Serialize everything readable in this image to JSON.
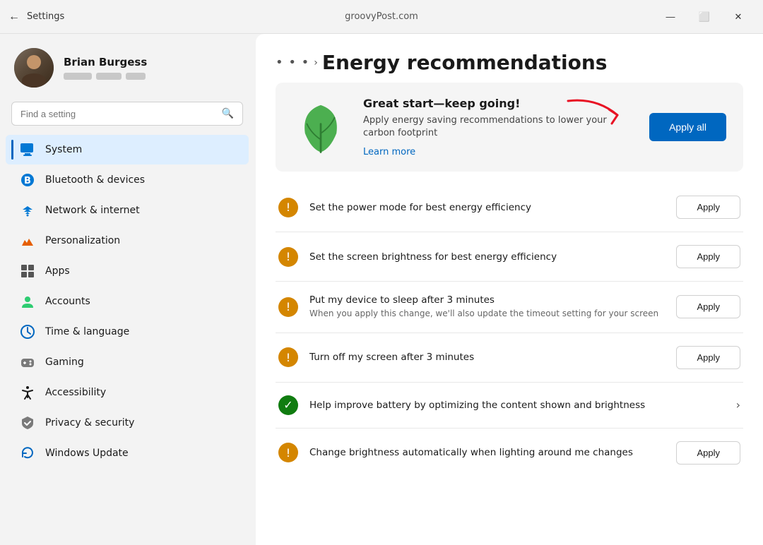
{
  "window": {
    "title": "Settings",
    "center_text": "groovyPost.com",
    "back_icon": "←",
    "minimize_icon": "—",
    "maximize_icon": "⬜",
    "close_icon": "✕"
  },
  "user": {
    "name": "Brian Burgess",
    "bar_widths": [
      40,
      36,
      28
    ]
  },
  "search": {
    "placeholder": "Find a setting"
  },
  "nav": {
    "items": [
      {
        "id": "system",
        "label": "System",
        "icon": "🖥",
        "active": true
      },
      {
        "id": "bluetooth",
        "label": "Bluetooth & devices",
        "icon": "⬡",
        "active": false
      },
      {
        "id": "network",
        "label": "Network & internet",
        "icon": "📶",
        "active": false
      },
      {
        "id": "personalization",
        "label": "Personalization",
        "icon": "✏",
        "active": false
      },
      {
        "id": "apps",
        "label": "Apps",
        "icon": "⊞",
        "active": false
      },
      {
        "id": "accounts",
        "label": "Accounts",
        "icon": "👤",
        "active": false
      },
      {
        "id": "time",
        "label": "Time & language",
        "icon": "🕐",
        "active": false
      },
      {
        "id": "gaming",
        "label": "Gaming",
        "icon": "🎮",
        "active": false
      },
      {
        "id": "accessibility",
        "label": "Accessibility",
        "icon": "♿",
        "active": false
      },
      {
        "id": "privacy",
        "label": "Privacy & security",
        "icon": "🛡",
        "active": false
      },
      {
        "id": "update",
        "label": "Windows Update",
        "icon": "🔄",
        "active": false
      }
    ]
  },
  "page": {
    "breadcrumb_dots": "• • •",
    "breadcrumb_arrow": "›",
    "title": "Energy recommendations",
    "hero": {
      "title": "Great start—keep going!",
      "description": "Apply energy saving recommendations to lower your carbon footprint",
      "link_text": "Learn more",
      "apply_all_label": "Apply all"
    },
    "recommendations": [
      {
        "id": "power-mode",
        "icon_type": "warning",
        "icon_symbol": "!",
        "title": "Set the power mode for best energy efficiency",
        "subtitle": "",
        "action": "apply",
        "apply_label": "Apply",
        "has_chevron": false
      },
      {
        "id": "brightness",
        "icon_type": "warning",
        "icon_symbol": "!",
        "title": "Set the screen brightness for best energy efficiency",
        "subtitle": "",
        "action": "apply",
        "apply_label": "Apply",
        "has_chevron": false
      },
      {
        "id": "sleep",
        "icon_type": "warning",
        "icon_symbol": "!",
        "title": "Put my device to sleep after 3 minutes",
        "subtitle": "When you apply this change, we'll also update the timeout setting for your screen",
        "action": "apply",
        "apply_label": "Apply",
        "has_chevron": false
      },
      {
        "id": "screen-off",
        "icon_type": "warning",
        "icon_symbol": "!",
        "title": "Turn off my screen after 3 minutes",
        "subtitle": "",
        "action": "apply",
        "apply_label": "Apply",
        "has_chevron": false
      },
      {
        "id": "battery",
        "icon_type": "success",
        "icon_symbol": "✓",
        "title": "Help improve battery by optimizing the content shown and brightness",
        "subtitle": "",
        "action": "chevron",
        "apply_label": "",
        "has_chevron": true
      },
      {
        "id": "auto-brightness",
        "icon_type": "warning",
        "icon_symbol": "!",
        "title": "Change brightness automatically when lighting around me changes",
        "subtitle": "",
        "action": "apply",
        "apply_label": "Apply",
        "has_chevron": false
      }
    ]
  },
  "colors": {
    "accent_blue": "#0067c0",
    "warning_orange": "#d48600",
    "success_green": "#107c10",
    "active_bg": "#ddeeff",
    "active_bar": "#0067c0"
  }
}
